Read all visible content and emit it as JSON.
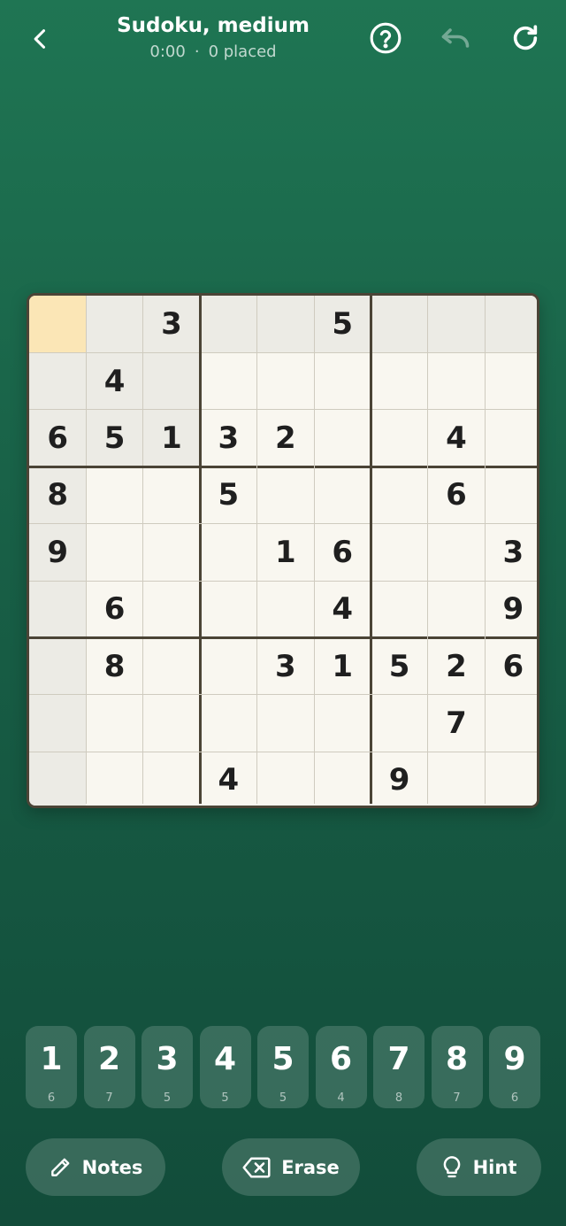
{
  "header": {
    "title": "Sudoku, medium",
    "timer": "0:00",
    "separator": "·",
    "placed": "0 placed",
    "icons": {
      "back": "chevron-left-icon",
      "help": "help-circle-icon",
      "undo": "undo-icon",
      "restart": "restart-icon"
    }
  },
  "board": {
    "selected": [
      0,
      0
    ],
    "highlighted_peers": "row 0, column 0, top-left box",
    "grid": [
      [
        "",
        "",
        "3",
        "",
        "",
        "5",
        "",
        "",
        ""
      ],
      [
        "",
        "4",
        "",
        "",
        "",
        "",
        "",
        "",
        ""
      ],
      [
        "6",
        "5",
        "1",
        "3",
        "2",
        "",
        "",
        "4",
        ""
      ],
      [
        "8",
        "",
        "",
        "5",
        "",
        "",
        "",
        "6",
        ""
      ],
      [
        "9",
        "",
        "",
        "",
        "1",
        "6",
        "",
        "",
        "3"
      ],
      [
        "",
        "6",
        "",
        "",
        "",
        "4",
        "",
        "",
        "9"
      ],
      [
        "",
        "8",
        "",
        "",
        "3",
        "1",
        "5",
        "2",
        "6"
      ],
      [
        "",
        "",
        "",
        "",
        "",
        "",
        "",
        "7",
        ""
      ],
      [
        "",
        "",
        "",
        "4",
        "",
        "",
        "9",
        "",
        ""
      ]
    ]
  },
  "numpad": [
    {
      "digit": "1",
      "remaining": "6"
    },
    {
      "digit": "2",
      "remaining": "7"
    },
    {
      "digit": "3",
      "remaining": "5"
    },
    {
      "digit": "4",
      "remaining": "5"
    },
    {
      "digit": "5",
      "remaining": "5"
    },
    {
      "digit": "6",
      "remaining": "4"
    },
    {
      "digit": "7",
      "remaining": "8"
    },
    {
      "digit": "8",
      "remaining": "7"
    },
    {
      "digit": "9",
      "remaining": "6"
    }
  ],
  "actions": {
    "notes": {
      "label": "Notes",
      "icon": "pencil-icon"
    },
    "erase": {
      "label": "Erase",
      "icon": "backspace-icon"
    },
    "hint": {
      "label": "Hint",
      "icon": "lightbulb-icon"
    }
  },
  "colors": {
    "background_top": "#1f7553",
    "background_bottom": "#124c3a",
    "board_bg": "#f9f7f0",
    "selected_cell": "#fbe6b6",
    "peer_cell": "#ecebe5",
    "digit": "#1f1f1f"
  }
}
